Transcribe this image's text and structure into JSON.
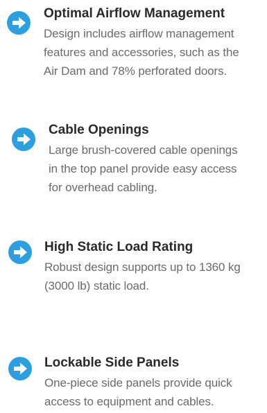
{
  "accent_color": "#2b9fe0",
  "features": [
    {
      "icon": "arrow-right-circle-icon",
      "title": "Optimal Airflow Management",
      "description_lines": [
        "Design includes airflow management",
        "features and accessories, such as the",
        "Air Dam and 78% perforated doors."
      ]
    },
    {
      "icon": "arrow-right-circle-icon",
      "title": "Cable Openings",
      "description_lines": [
        "Large brush-covered cable openings",
        "in the top panel provide easy access",
        "for overhead cabling."
      ]
    },
    {
      "icon": "arrow-right-circle-icon",
      "title": "High Static Load Rating",
      "description_lines": [
        "Robust design supports up to 1360 kg",
        "(3000 lb) static load."
      ]
    },
    {
      "icon": "arrow-right-circle-icon",
      "title": "Lockable Side Panels",
      "description_lines": [
        "One-piece side panels provide quick",
        "access to equipment and cables."
      ]
    }
  ]
}
